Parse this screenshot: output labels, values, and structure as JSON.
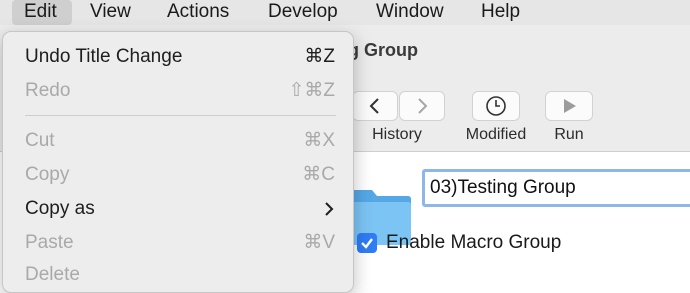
{
  "menubar": {
    "items": [
      "Edit",
      "View",
      "Actions",
      "Develop",
      "Window",
      "Help"
    ]
  },
  "window": {
    "title": "ng Group",
    "toolbar": [
      {
        "label": "History",
        "icon": "back-forward-icon"
      },
      {
        "label": "Modified",
        "icon": "clock-icon"
      },
      {
        "label": "Run",
        "icon": "play-icon"
      }
    ],
    "group_name_value": "03)Testing Group",
    "enable_checkbox": {
      "label": "Enable Macro Group",
      "checked": true
    }
  },
  "edit_menu": {
    "items": [
      {
        "label": "Undo Title Change",
        "shortcut": "⌘Z",
        "enabled": true
      },
      {
        "label": "Redo",
        "shortcut": "⇧⌘Z",
        "enabled": false
      },
      {
        "label": "Cut",
        "shortcut": "⌘X",
        "enabled": false
      },
      {
        "label": "Copy",
        "shortcut": "⌘C",
        "enabled": false
      },
      {
        "label": "Copy as",
        "shortcut": "",
        "enabled": true,
        "submenu": true
      },
      {
        "label": "Paste",
        "shortcut": "⌘V",
        "enabled": false
      },
      {
        "label": "Delete",
        "shortcut": "",
        "enabled": false
      }
    ]
  },
  "colors": {
    "accent": "#2f7cf6",
    "menubar_bg": "#e6e6e6",
    "menu_bg": "#ededed"
  }
}
